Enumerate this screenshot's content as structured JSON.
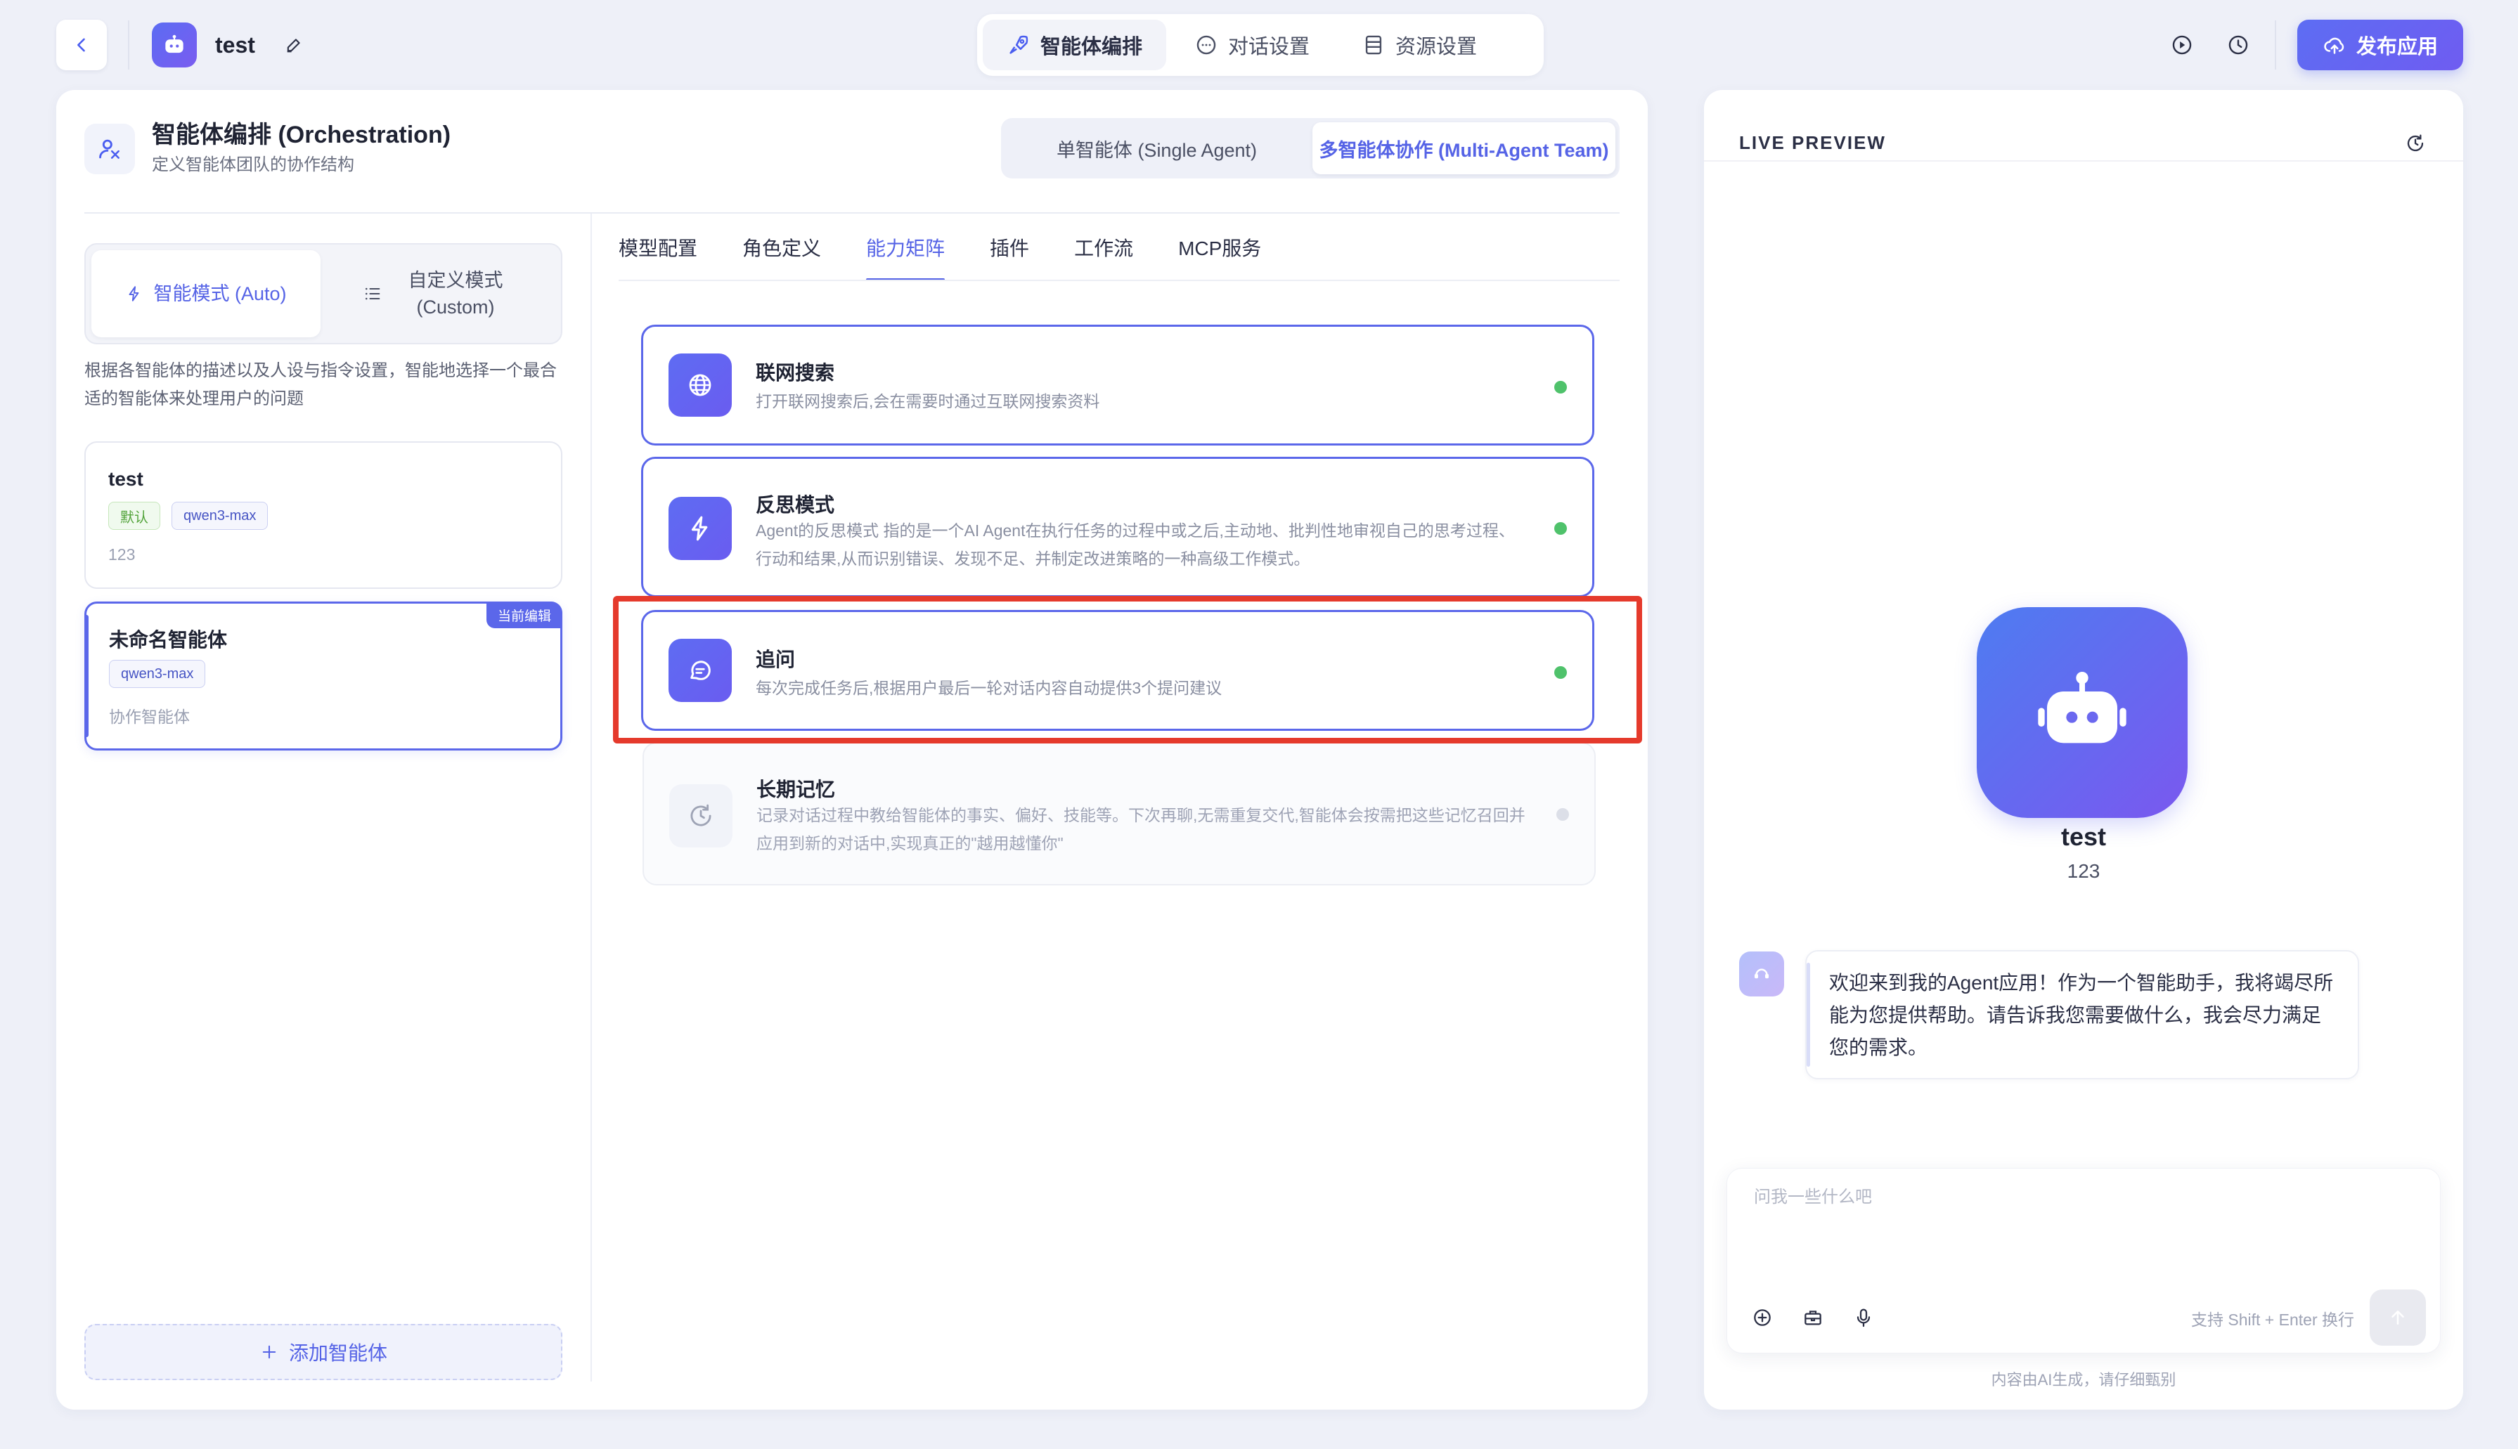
{
  "colors": {
    "accent": "#5b67ea",
    "highlight": "#e53a2c",
    "status_on": "#4fc26b"
  },
  "header": {
    "app_name": "test",
    "tabs": [
      {
        "label": "智能体编排",
        "icon": "rocket-icon",
        "active": true
      },
      {
        "label": "对话设置",
        "icon": "chat-bubble-icon",
        "active": false
      },
      {
        "label": "资源设置",
        "icon": "document-icon",
        "active": false
      }
    ],
    "publish_label": "发布应用"
  },
  "orchestration": {
    "title": "智能体编排 (Orchestration)",
    "subtitle": "定义智能体团队的协作结构",
    "mode_tabs": [
      {
        "label": "单智能体 (Single Agent)",
        "active": false
      },
      {
        "label": "多智能体协作 (Multi-Agent Team)",
        "active": true
      }
    ]
  },
  "left": {
    "auto_label": "智能模式 (Auto)",
    "custom_label": "自定义模式\n(Custom)",
    "auto_desc": "根据各智能体的描述以及人设与指令设置，智能地选择一个最合适的智能体来处理用户的问题",
    "agents": [
      {
        "name": "test",
        "tags": [
          "默认",
          "qwen3-max"
        ],
        "desc": "123",
        "selected": false
      },
      {
        "name": "未命名智能体",
        "tags": [
          "qwen3-max"
        ],
        "desc": "协作智能体",
        "selected": true,
        "badge": "当前编辑"
      }
    ],
    "add_label": "添加智能体"
  },
  "subtabs": [
    {
      "label": "模型配置",
      "active": false
    },
    {
      "label": "角色定义",
      "active": false
    },
    {
      "label": "能力矩阵",
      "active": true
    },
    {
      "label": "插件",
      "active": false
    },
    {
      "label": "工作流",
      "active": false
    },
    {
      "label": "MCP服务",
      "active": false
    }
  ],
  "capabilities": [
    {
      "title": "联网搜索",
      "desc": "打开联网搜索后,会在需要时通过互联网搜索资料",
      "icon": "globe-icon",
      "enabled": true
    },
    {
      "title": "反思模式",
      "desc": "Agent的反思模式 指的是一个AI Agent在执行任务的过程中或之后,主动地、批判性地审视自己的思考过程、行动和结果,从而识别错误、发现不足、并制定改进策略的一种高级工作模式。",
      "icon": "lightning-icon",
      "enabled": true
    },
    {
      "title": "追问",
      "desc": "每次完成任务后,根据用户最后一轮对话内容自动提供3个提问建议",
      "icon": "chat-icon",
      "enabled": true
    },
    {
      "title": "长期记忆",
      "desc": "记录对话过程中教给智能体的事实、偏好、技能等。下次再聊,无需重复交代,智能体会按需把这些记忆召回并应用到新的对话中,实现真正的\"越用越懂你\"",
      "icon": "memory-clock-icon",
      "enabled": false
    }
  ],
  "preview": {
    "title": "LIVE PREVIEW",
    "bot_name": "test",
    "bot_desc": "123",
    "welcome": "欢迎来到我的Agent应用！作为一个智能助手，我将竭尽所能为您提供帮助。请告诉我您需要做什么，我会尽力满足您的需求。",
    "input_placeholder": "问我一些什么吧",
    "input_hint": "支持 Shift + Enter 换行",
    "ai_note": "内容由AI生成，请仔细甄别"
  }
}
